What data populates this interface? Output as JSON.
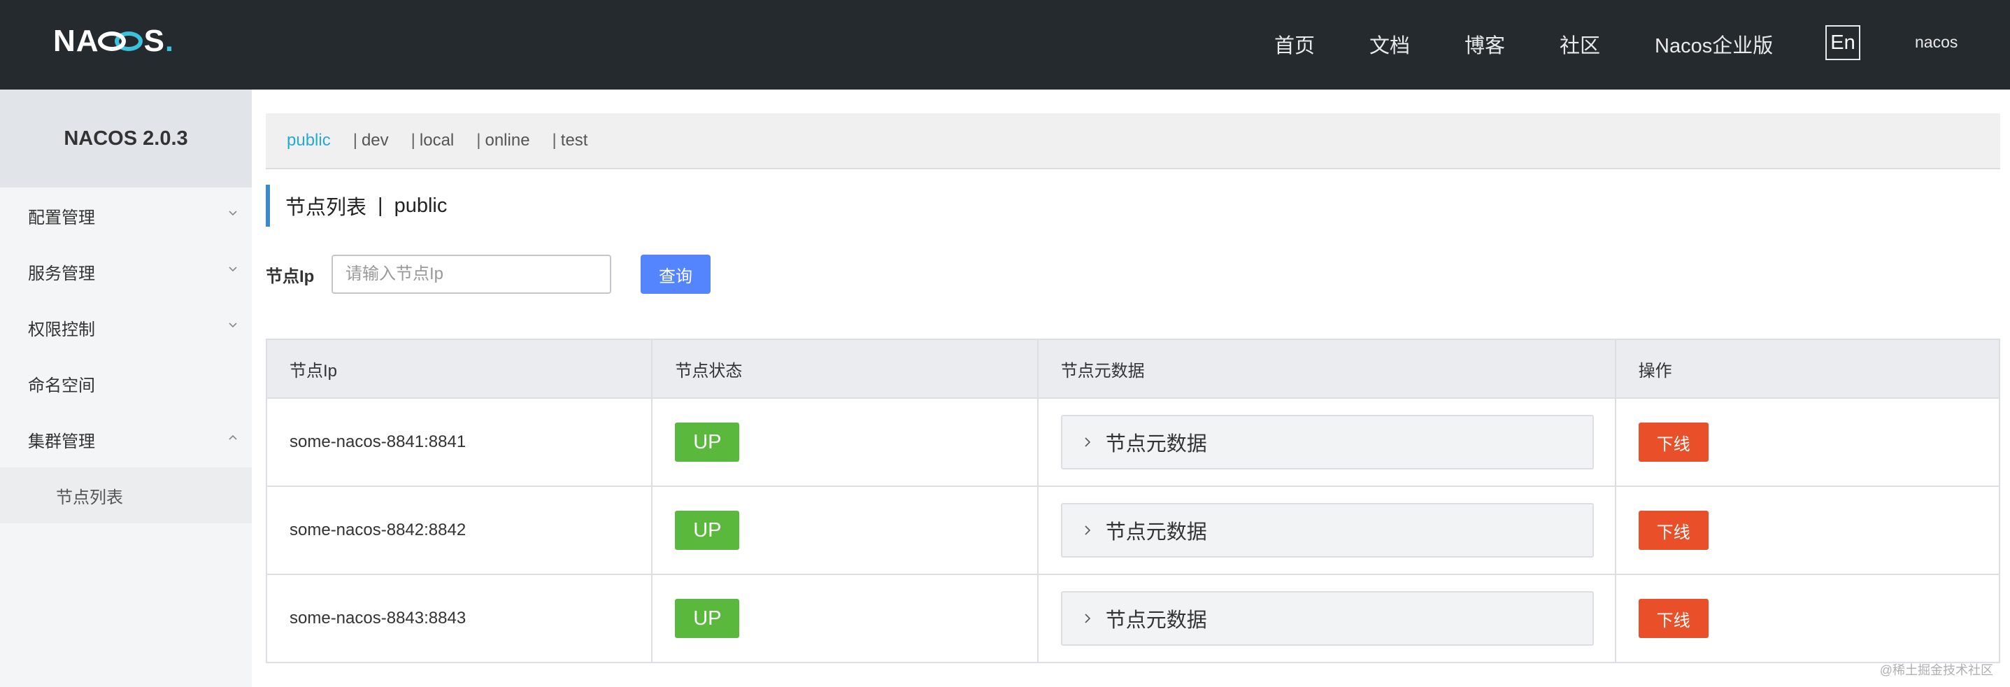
{
  "header": {
    "logo_text_a": "NA",
    "logo_text_b": "S",
    "logo_dot": ".",
    "nav": [
      "首页",
      "文档",
      "博客",
      "社区",
      "Nacos企业版"
    ],
    "lang": "En",
    "user": "nacos"
  },
  "sidebar": {
    "version": "NACOS 2.0.3",
    "items": [
      {
        "label": "配置管理",
        "chevron": "down"
      },
      {
        "label": "服务管理",
        "chevron": "down"
      },
      {
        "label": "权限控制",
        "chevron": "down"
      },
      {
        "label": "命名空间",
        "chevron": ""
      },
      {
        "label": "集群管理",
        "chevron": "up"
      }
    ],
    "sub_items": [
      "节点列表"
    ]
  },
  "namespaces": {
    "active": "public",
    "others": [
      "dev",
      "local",
      "online",
      "test"
    ],
    "separator": "|"
  },
  "page": {
    "title": "节点列表",
    "separator": "|",
    "namespace": "public"
  },
  "search": {
    "label": "节点Ip",
    "placeholder": "请输入节点Ip",
    "button": "查询"
  },
  "table": {
    "columns": [
      "节点Ip",
      "节点状态",
      "节点元数据",
      "操作"
    ],
    "rows": [
      {
        "ip": "some-nacos-8841:8841",
        "status": "UP",
        "meta": "节点元数据",
        "action": "下线"
      },
      {
        "ip": "some-nacos-8842:8842",
        "status": "UP",
        "meta": "节点元数据",
        "action": "下线"
      },
      {
        "ip": "some-nacos-8843:8843",
        "status": "UP",
        "meta": "节点元数据",
        "action": "下线"
      }
    ]
  },
  "watermark": "@稀土掘金技术社区",
  "colors": {
    "topbar": "#252a2f",
    "accent": "#29a8d6",
    "primary_button": "#5584ff",
    "up_badge": "#5ab83c",
    "offline_button": "#e9502a"
  }
}
